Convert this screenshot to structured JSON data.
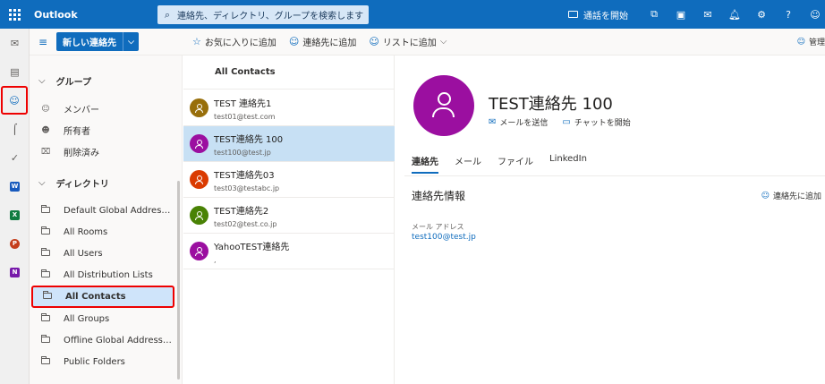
{
  "app": {
    "title": "Outlook"
  },
  "search": {
    "placeholder": "連絡先、ディレクトリ、グループを検索します"
  },
  "topbar": {
    "meet_label": "通話を開始"
  },
  "command": {
    "new_contact": "新しい連絡先",
    "favorite": "お気に入りに追加",
    "add_contact": "連絡先に追加",
    "add_list": "リストに追加",
    "manage": "管理"
  },
  "nav": {
    "groups_header": "グループ",
    "group_items": [
      {
        "label": "メンバー",
        "icon": "members-icon"
      },
      {
        "label": "所有者",
        "icon": "owner-icon"
      },
      {
        "label": "削除済み",
        "icon": "trash-icon"
      }
    ],
    "directory_header": "ディレクトリ",
    "directory_items": [
      {
        "label": "Default Global Addres…"
      },
      {
        "label": "All Rooms"
      },
      {
        "label": "All Users"
      },
      {
        "label": "All Distribution Lists"
      },
      {
        "label": "All Contacts",
        "active": true
      },
      {
        "label": "All Groups"
      },
      {
        "label": "Offline Global Address…"
      },
      {
        "label": "Public Folders"
      }
    ]
  },
  "list": {
    "header": "All Contacts",
    "contacts": [
      {
        "name": "TEST 連絡先1",
        "email": "test01@test.com",
        "color": "#986f0b"
      },
      {
        "name": "TEST連絡先 100",
        "email": "test100@test.jp",
        "color": "#9b0fa0",
        "selected": true
      },
      {
        "name": "TEST連絡先03",
        "email": "test03@testabc.jp",
        "color": "#da3b01"
      },
      {
        "name": "TEST連絡先2",
        "email": "test02@test.co.jp",
        "color": "#498205"
      },
      {
        "name": "YahooTEST連絡先",
        "email": ",",
        "color": "#9b0fa0"
      }
    ]
  },
  "detail": {
    "name": "TEST連絡先 100",
    "send_mail": "メールを送信",
    "start_chat": "チャットを開始",
    "tabs": [
      "連絡先",
      "メール",
      "ファイル",
      "LinkedIn"
    ],
    "section_title": "連絡先情報",
    "add_to_contacts": "連絡先に追加",
    "email_label": "メール アドレス",
    "email_value": "test100@test.jp"
  }
}
